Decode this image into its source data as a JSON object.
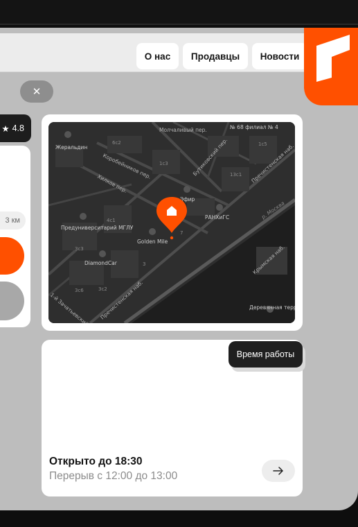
{
  "nav": {
    "about": "О нас",
    "sellers": "Продавцы",
    "news": "Новости"
  },
  "close": {
    "icon": "close-icon",
    "glyph": "✕"
  },
  "side_card": {
    "rating": "4.8",
    "rating_icon": "star-icon",
    "distance": "3 км"
  },
  "map": {
    "streets": [
      "Молчаливый пер.",
      "Коробейников пер.",
      "Хилков пер.",
      "Бутиковский пер.",
      "Пречистенская наб.",
      "Крымская наб.",
      "1-й Зачатьевский пр-д",
      "Пречистенская наб."
    ],
    "pois": [
      "Жеральдин",
      "Эфир",
      "Предуниверситарий МГЛУ",
      "Golden Mile",
      "РАНХиГС",
      "DiamondCar",
      "Деревянная терраса",
      "№ 68 филиал № 4"
    ],
    "river": "р. Москва",
    "house_numbers": [
      "6с2",
      "1с3",
      "1с5",
      "13с1",
      "3с3",
      "3с2",
      "3с6",
      "3",
      "7",
      "4с1"
    ],
    "pin_color": "#ff5000"
  },
  "hours": {
    "chip_label": "Время работы",
    "open_until": "Открыто до 18:30",
    "break": "Перерыв с 12:00 до 13:00",
    "arrow_icon": "arrow-right-icon"
  },
  "colors": {
    "accent": "#ff5000",
    "chip_dark": "#1f1f1f"
  }
}
